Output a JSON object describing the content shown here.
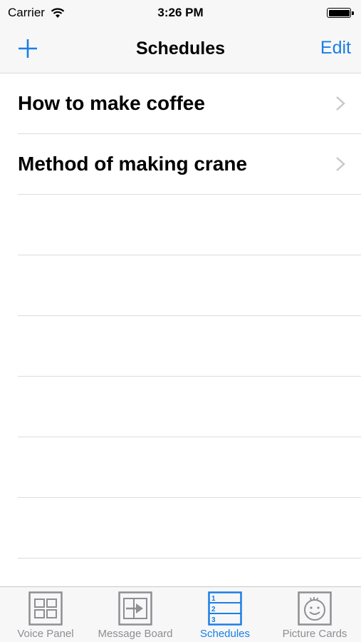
{
  "status_bar": {
    "carrier": "Carrier",
    "time": "3:26 PM"
  },
  "nav": {
    "title": "Schedules",
    "edit_label": "Edit",
    "add_icon": "plus-icon"
  },
  "schedules": [
    {
      "label": "How to make coffee"
    },
    {
      "label": "Method of making crane"
    }
  ],
  "tabs": [
    {
      "label": "Voice Panel",
      "icon": "voice-panel-icon",
      "active": false
    },
    {
      "label": "Message Board",
      "icon": "message-board-icon",
      "active": false
    },
    {
      "label": "Schedules",
      "icon": "schedules-icon",
      "active": true
    },
    {
      "label": "Picture Cards",
      "icon": "picture-cards-icon",
      "active": false
    }
  ],
  "colors": {
    "accent": "#1a7ee6",
    "inactive_tab": "#8e8e93",
    "bar_background": "#f7f7f7"
  }
}
